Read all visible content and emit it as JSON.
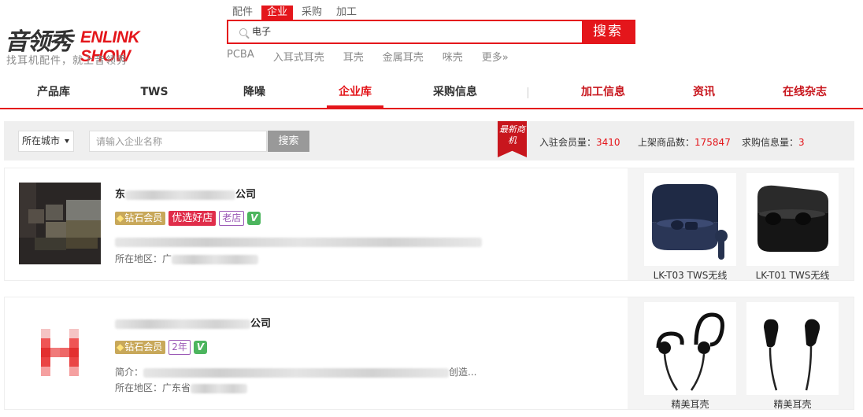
{
  "header": {
    "logo_cn": "音领秀",
    "logo_en": "ENLINK SHOW",
    "slogan": "找耳机配件，就上音领秀",
    "search_tabs": [
      "配件",
      "企业",
      "采购",
      "加工"
    ],
    "active_search_tab": "企业",
    "search_value": "电子",
    "search_button": "搜索",
    "hot_words": [
      "PCBA",
      "入耳式耳壳",
      "耳壳",
      "金属耳壳",
      "咪壳",
      "更多»"
    ]
  },
  "nav": {
    "items": [
      "产品库",
      "TWS",
      "降噪",
      "企业库",
      "采购信息",
      "加工信息",
      "资讯",
      "在线杂志"
    ],
    "active": "企业库"
  },
  "filter": {
    "city_label": "所在城市",
    "company_placeholder": "请输入企业名称",
    "search_button": "搜索",
    "new_badge": "最新商机",
    "stats": [
      {
        "label": "入驻会员量：",
        "value": "3410"
      },
      {
        "label": "上架商品数：",
        "value": "175847"
      },
      {
        "label": "求购信息量：",
        "value": "3"
      }
    ]
  },
  "companies": [
    {
      "name_visible_prefix": "东",
      "name_visible_suffix": "公司",
      "badges": {
        "diamond": "钻石会员",
        "youxuan": "优选好店",
        "age": "老店",
        "verified": "V"
      },
      "intro_label": "",
      "intro_visible_tail": "",
      "region_label": "所在地区：广",
      "products": [
        {
          "name": "LK-T03 TWS无线"
        },
        {
          "name": "LK-T01 TWS无线"
        }
      ]
    },
    {
      "name_visible_prefix": "",
      "name_visible_suffix": "公司",
      "badges": {
        "diamond": "钻石会员",
        "age": "2年",
        "verified": "V"
      },
      "intro_label": "简介：",
      "intro_visible_tail": "创造...",
      "region_label": "所在地区：广东省",
      "products": [
        {
          "name": "精美耳壳"
        },
        {
          "name": "精美耳壳"
        }
      ]
    }
  ],
  "colors": {
    "brand_red": "#e4161b",
    "diamond_gold": "#c8a85a",
    "youxuan_red": "#e02d4a",
    "age_purple": "#9b59b6",
    "verified_green": "#4cb55e"
  }
}
